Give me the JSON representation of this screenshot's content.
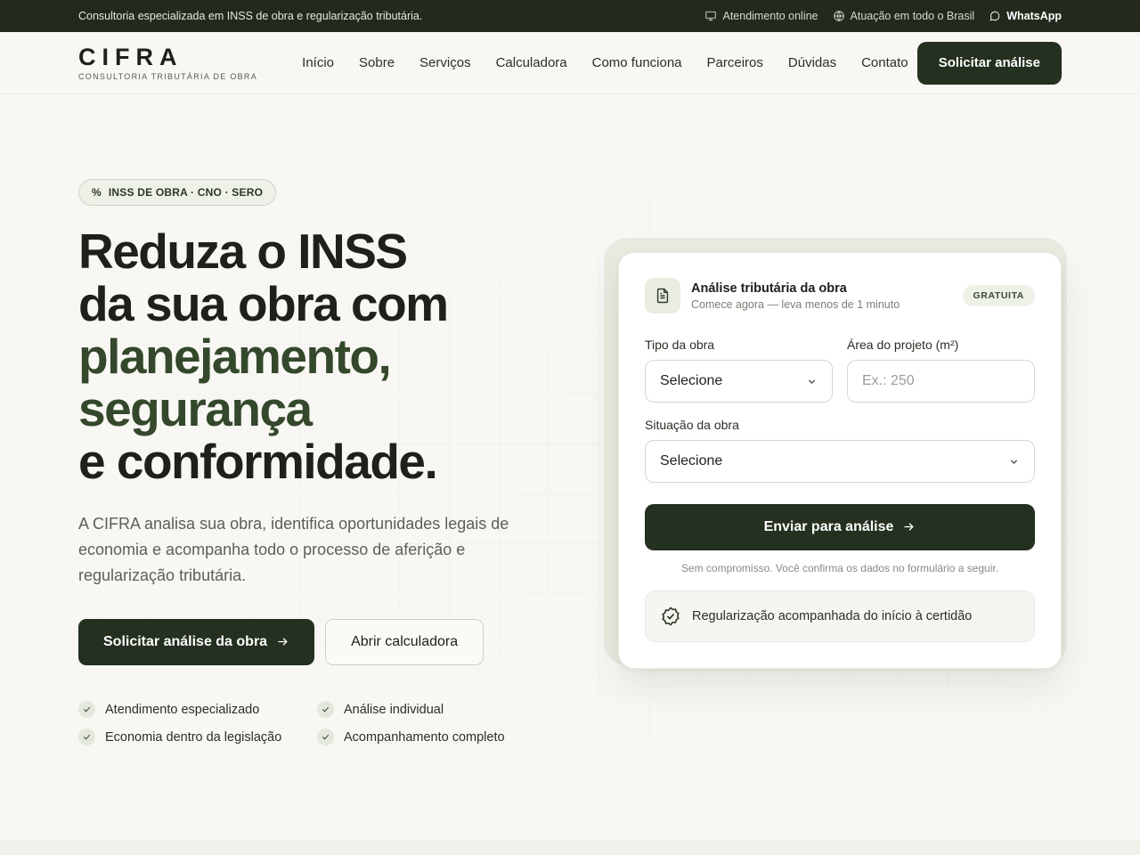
{
  "topbar": {
    "tagline": "Consultoria especializada em INSS de obra e regularização tributária.",
    "items": [
      {
        "icon": "monitor-icon",
        "label": "Atendimento online"
      },
      {
        "icon": "globe-icon",
        "label": "Atuação em todo o Brasil"
      },
      {
        "icon": "whatsapp-icon",
        "label": "WhatsApp"
      }
    ]
  },
  "header": {
    "brand_name": "CIFRA",
    "brand_sub": "CONSULTORIA TRIBUTÁRIA DE OBRA",
    "nav": [
      "Início",
      "Sobre",
      "Serviços",
      "Calculadora",
      "Como funciona",
      "Parceiros",
      "Dúvidas",
      "Contato"
    ],
    "cta": "Solicitar análise"
  },
  "hero": {
    "badge": "INSS DE OBRA · CNO · SERO",
    "badge_icon": "percent-icon",
    "headline": {
      "line1": "Reduza o INSS",
      "line2": "da sua obra com",
      "accent1": "planejamento,",
      "accent2": "segurança",
      "line5": "e conformidade."
    },
    "lead": "A CIFRA analisa sua obra, identifica oportunidades legais de economia e acompanha todo o processo de aferição e regularização tributária.",
    "primary_cta": "Solicitar análise da obra",
    "secondary_cta": "Abrir calculadora",
    "features": [
      "Atendimento especializado",
      "Análise individual",
      "Economia dentro da legislação",
      "Acompanhamento completo"
    ]
  },
  "form": {
    "title": "Análise tributária da obra",
    "subtitle": "Comece agora — leva menos de 1 minuto",
    "badge": "GRATUITA",
    "tipo_label": "Tipo da obra",
    "tipo_value": "Selecione",
    "area_label": "Área do projeto (m²)",
    "area_placeholder": "Ex.: 250",
    "situacao_label": "Situação da obra",
    "situacao_value": "Selecione",
    "submit": "Enviar para análise",
    "disclaimer": "Sem compromisso. Você confirma os dados no formulário a seguir.",
    "assurance": "Regularização acompanhada do início à certidão"
  },
  "colors": {
    "primary": "#243020",
    "accent_text": "#34482c",
    "background": "#f8f7f3",
    "topbar": "#232a1d"
  }
}
